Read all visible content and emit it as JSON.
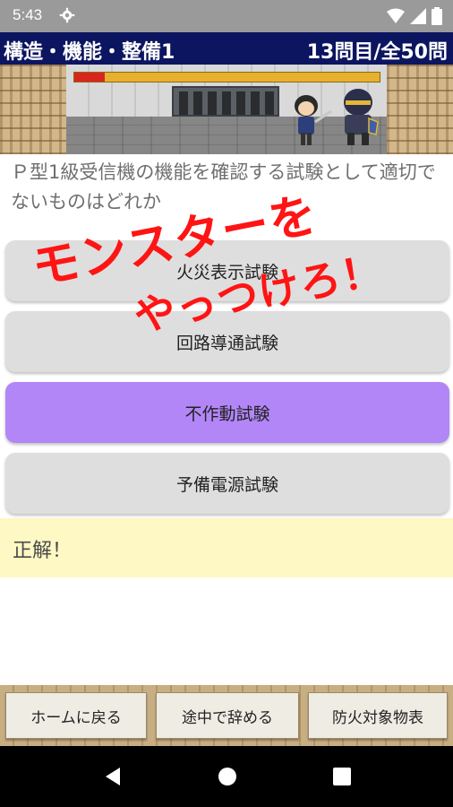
{
  "status_bar": {
    "time": "5:43"
  },
  "header": {
    "title": "構造・機能・整備1",
    "progress": "13問目/全50問"
  },
  "battle": {
    "monster_hp": 0.1
  },
  "question": {
    "text": "Ｐ型1級受信機の機能を確認する試験として適切でないものはどれか"
  },
  "choices": [
    {
      "label": "火災表示試験",
      "selected": false
    },
    {
      "label": "回路導通試験",
      "selected": false
    },
    {
      "label": "不作動試験",
      "selected": true
    },
    {
      "label": "予備電源試験",
      "selected": false
    }
  ],
  "overlay": {
    "line1": "モンスターを",
    "line2": "やっつけろ！"
  },
  "result": {
    "text": "正解！"
  },
  "bottom_buttons": {
    "home": "ホームに戻る",
    "quit": "途中で辞める",
    "table": "防火対象物表"
  },
  "colors": {
    "header_bg": "#0c1560",
    "selected_choice": "#b386f8",
    "overlay_text": "#ff1414",
    "result_bg": "#fdf8c4"
  }
}
